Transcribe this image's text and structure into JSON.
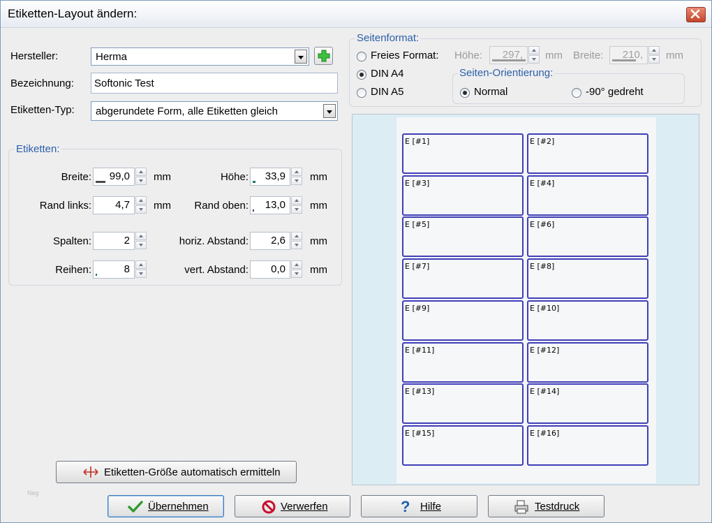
{
  "window": {
    "title": "Etiketten-Layout ändern:"
  },
  "colors": {
    "accent": "#2c5fa8",
    "label_border": "#3f3fb8",
    "preview_bg": "#dcedf4"
  },
  "top": {
    "hersteller_label": "Hersteller:",
    "hersteller_value": "Herma",
    "bezeichnung_label": "Bezeichnung:",
    "bezeichnung_value": "Softonic Test",
    "typ_label": "Etiketten-Typ:",
    "typ_value": "abgerundete Form, alle Etiketten gleich"
  },
  "etiketten": {
    "title": "Etiketten:",
    "breite_label": "Breite:",
    "breite_value": "99,0",
    "hoehe_label": "Höhe:",
    "hoehe_value": "33,9",
    "rand_links_label": "Rand links:",
    "rand_links_value": "4,7",
    "rand_oben_label": "Rand oben:",
    "rand_oben_value": "13,0",
    "spalten_label": "Spalten:",
    "spalten_value": "2",
    "horiz_label": "horiz. Abstand:",
    "horiz_value": "2,6",
    "reihen_label": "Reihen:",
    "reihen_value": "8",
    "vert_label": "vert. Abstand:",
    "vert_value": "0,0",
    "unit": "mm"
  },
  "seitenformat": {
    "title": "Seitenformat:",
    "freies_label": "Freies Format:",
    "din_a4_label": "DIN A4",
    "din_a5_label": "DIN A5",
    "selected": "DIN A4",
    "hoehe_label": "Höhe:",
    "hoehe_value": "297,",
    "breite_label": "Breite:",
    "breite_value": "210,",
    "unit": "mm"
  },
  "orientierung": {
    "title": "Seiten-Orientierung:",
    "normal_label": "Normal",
    "gedreht_label": "-90° gedreht",
    "selected": "Normal"
  },
  "preview": {
    "labels": [
      "E [#1]",
      "E [#2]",
      "E [#3]",
      "E [#4]",
      "E [#5]",
      "E [#6]",
      "E [#7]",
      "E [#8]",
      "E [#9]",
      "E [#10]",
      "E [#11]",
      "E [#12]",
      "E [#13]",
      "E [#14]",
      "E [#15]",
      "E [#16]"
    ]
  },
  "buttons": {
    "auto_size": "Etiketten-Größe automatisch ermitteln",
    "uebernehmen": "Übernehmen",
    "verwerfen": "Verwerfen",
    "hilfe": "Hilfe",
    "testdruck": "Testdruck"
  },
  "footer": {
    "note": "Neg"
  }
}
